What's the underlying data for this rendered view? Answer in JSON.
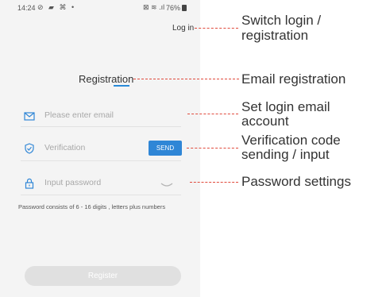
{
  "status_bar": {
    "time": "14:24",
    "left_icons": "⊘ ▰ ⌘ •",
    "right_icons": "⊠ ≋ .ıl",
    "battery": "76%"
  },
  "screen": {
    "login_link": "Log in",
    "title": "Registration",
    "email_placeholder": "Please enter email",
    "verification_placeholder": "Verification",
    "send_label": "SEND",
    "password_placeholder": "Input password",
    "password_hint": "Password consists of 6 - 16 digits , letters plus numbers",
    "register_label": "Register",
    "accent_color": "#2f86d6"
  },
  "annotations": {
    "switch_line1": "Switch login /",
    "switch_line2": "registration",
    "email_registration": "Email registration",
    "email_account_line1": "Set login email",
    "email_account_line2": "account",
    "verification_line1": "Verification code",
    "verification_line2": "sending / input",
    "password_settings": "Password settings"
  },
  "icons": {
    "email": "envelope-icon",
    "verification": "shield-check-icon",
    "password": "lock-icon",
    "visibility": "eye-closed-icon"
  }
}
